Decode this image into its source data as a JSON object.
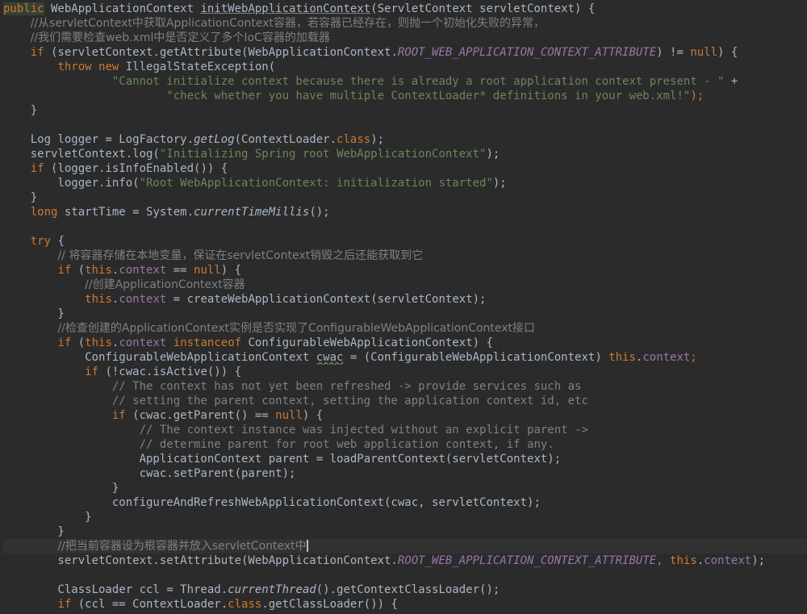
{
  "editor": {
    "caret_line": 37,
    "lines": [
      [
        {
          "t": "public",
          "c": "hlkw"
        },
        {
          "t": " WebApplicationContext ",
          "c": "pl"
        },
        {
          "t": "initWebApplicationContext",
          "c": "ul"
        },
        {
          "t": "(ServletContext servletContext) {",
          "c": "pl"
        }
      ],
      [
        {
          "t": "    ",
          "c": "pl"
        },
        {
          "t": "//从servletContext中获取ApplicationContext容器，若容器已经存在，则抛一个初始化失败的异常，",
          "c": "cmz"
        }
      ],
      [
        {
          "t": "    ",
          "c": "pl"
        },
        {
          "t": "//我们需要检查web.xml中是否定义了多个IoC容器的加载器",
          "c": "cmz"
        }
      ],
      [
        {
          "t": "    ",
          "c": "pl"
        },
        {
          "t": "if",
          "c": "kw"
        },
        {
          "t": " (servletContext.getAttribute(WebApplicationContext.",
          "c": "pl"
        },
        {
          "t": "ROOT_WEB_APPLICATION_CONTEXT_ATTRIBUTE",
          "c": "sfld"
        },
        {
          "t": ") != ",
          "c": "pl"
        },
        {
          "t": "null",
          "c": "kw"
        },
        {
          "t": ") {",
          "c": "pl"
        }
      ],
      [
        {
          "t": "        ",
          "c": "pl"
        },
        {
          "t": "throw new",
          "c": "kw"
        },
        {
          "t": " IllegalStateException(",
          "c": "pl"
        }
      ],
      [
        {
          "t": "                ",
          "c": "pl"
        },
        {
          "t": "\"Cannot initialize context because there is already a root application context present - \"",
          "c": "str"
        },
        {
          "t": " +",
          "c": "pl"
        }
      ],
      [
        {
          "t": "                        ",
          "c": "pl"
        },
        {
          "t": "\"check whether you have multiple ContextLoader* definitions in your web.xml!\"",
          "c": "str"
        },
        {
          "t": ");",
          "c": "kw"
        }
      ],
      [
        {
          "t": "    }",
          "c": "pl"
        }
      ],
      [],
      [
        {
          "t": "    Log logger = LogFactory.",
          "c": "pl"
        },
        {
          "t": "getLog",
          "c": "smeth"
        },
        {
          "t": "(ContextLoader.",
          "c": "pl"
        },
        {
          "t": "class",
          "c": "kw"
        },
        {
          "t": ");",
          "c": "pl"
        }
      ],
      [
        {
          "t": "    servletContext.log(",
          "c": "pl"
        },
        {
          "t": "\"Initializing Spring root WebApplicationContext\"",
          "c": "str"
        },
        {
          "t": ");",
          "c": "pl"
        }
      ],
      [
        {
          "t": "    ",
          "c": "pl"
        },
        {
          "t": "if",
          "c": "kw"
        },
        {
          "t": " (logger.isInfoEnabled()) {",
          "c": "pl"
        }
      ],
      [
        {
          "t": "        logger.info(",
          "c": "pl"
        },
        {
          "t": "\"Root WebApplicationContext: initialization started\"",
          "c": "str"
        },
        {
          "t": ");",
          "c": "pl"
        }
      ],
      [
        {
          "t": "    }",
          "c": "pl"
        }
      ],
      [
        {
          "t": "    ",
          "c": "pl"
        },
        {
          "t": "long",
          "c": "kw"
        },
        {
          "t": " startTime = System.",
          "c": "pl"
        },
        {
          "t": "currentTimeMillis",
          "c": "smeth"
        },
        {
          "t": "();",
          "c": "pl"
        }
      ],
      [],
      [
        {
          "t": "    ",
          "c": "pl"
        },
        {
          "t": "try",
          "c": "kw"
        },
        {
          "t": " {",
          "c": "pl"
        }
      ],
      [
        {
          "t": "        ",
          "c": "pl"
        },
        {
          "t": "// 将容器存储在本地变量，保证在servletContext销毁之后还能获取到它",
          "c": "cmz"
        }
      ],
      [
        {
          "t": "        ",
          "c": "pl"
        },
        {
          "t": "if",
          "c": "kw"
        },
        {
          "t": " (",
          "c": "pl"
        },
        {
          "t": "this",
          "c": "kw"
        },
        {
          "t": ".",
          "c": "pl"
        },
        {
          "t": "context",
          "c": "fld"
        },
        {
          "t": " == ",
          "c": "pl"
        },
        {
          "t": "null",
          "c": "kw"
        },
        {
          "t": ") {",
          "c": "pl"
        }
      ],
      [
        {
          "t": "            ",
          "c": "pl"
        },
        {
          "t": "//创建ApplicationContext容器",
          "c": "cmz"
        }
      ],
      [
        {
          "t": "            ",
          "c": "pl"
        },
        {
          "t": "this",
          "c": "kw"
        },
        {
          "t": ".",
          "c": "pl"
        },
        {
          "t": "context",
          "c": "fld"
        },
        {
          "t": " = createWebApplicationContext(servletContext);",
          "c": "pl"
        }
      ],
      [
        {
          "t": "        }",
          "c": "pl"
        }
      ],
      [
        {
          "t": "        ",
          "c": "pl"
        },
        {
          "t": "//检查创建的ApplicationContext实例是否实现了ConfigurableWebApplicationContext接口",
          "c": "cmz"
        }
      ],
      [
        {
          "t": "        ",
          "c": "pl"
        },
        {
          "t": "if",
          "c": "kw"
        },
        {
          "t": " (",
          "c": "pl"
        },
        {
          "t": "this",
          "c": "kw"
        },
        {
          "t": ".",
          "c": "pl"
        },
        {
          "t": "context",
          "c": "fld"
        },
        {
          "t": " ",
          "c": "pl"
        },
        {
          "t": "instanceof",
          "c": "kw"
        },
        {
          "t": " ConfigurableWebApplicationContext) {",
          "c": "pl"
        }
      ],
      [
        {
          "t": "            ConfigurableWebApplicationContext ",
          "c": "pl"
        },
        {
          "t": "cwac",
          "c": "squig"
        },
        {
          "t": " = (ConfigurableWebApplicationContext) ",
          "c": "pl"
        },
        {
          "t": "this",
          "c": "kw"
        },
        {
          "t": ".",
          "c": "pl"
        },
        {
          "t": "context",
          "c": "fld"
        },
        {
          "t": ";",
          "c": "kw"
        }
      ],
      [
        {
          "t": "            ",
          "c": "pl"
        },
        {
          "t": "if",
          "c": "kw"
        },
        {
          "t": " (!cwac.isActive()) {",
          "c": "pl"
        }
      ],
      [
        {
          "t": "                ",
          "c": "pl"
        },
        {
          "t": "// The context has not yet been refreshed -> provide services such as",
          "c": "cm"
        }
      ],
      [
        {
          "t": "                ",
          "c": "pl"
        },
        {
          "t": "// setting the parent context, setting the application context id, etc",
          "c": "cm"
        }
      ],
      [
        {
          "t": "                ",
          "c": "pl"
        },
        {
          "t": "if",
          "c": "kw"
        },
        {
          "t": " (cwac.getParent() == ",
          "c": "pl"
        },
        {
          "t": "null",
          "c": "kw"
        },
        {
          "t": ") {",
          "c": "pl"
        }
      ],
      [
        {
          "t": "                    ",
          "c": "pl"
        },
        {
          "t": "// The context instance was injected without an explicit parent ->",
          "c": "cm"
        }
      ],
      [
        {
          "t": "                    ",
          "c": "pl"
        },
        {
          "t": "// determine parent for root web application context, if any.",
          "c": "cm"
        }
      ],
      [
        {
          "t": "                    ApplicationContext parent = loadParentContext(servletContext);",
          "c": "pl"
        }
      ],
      [
        {
          "t": "                    cwac.setParent(parent);",
          "c": "pl"
        }
      ],
      [
        {
          "t": "                }",
          "c": "pl"
        }
      ],
      [
        {
          "t": "                configureAndRefreshWebApplicationContext(cwac, servletContext);",
          "c": "pl"
        }
      ],
      [
        {
          "t": "            }",
          "c": "pl"
        }
      ],
      [
        {
          "t": "        }",
          "c": "pl"
        }
      ],
      [
        {
          "t": "        ",
          "c": "pl"
        },
        {
          "t": "//把当前容器设为根容器并放入servletContext中",
          "c": "cmz"
        }
      ],
      [
        {
          "t": "        servletContext.setAttribute(WebApplicationContext.",
          "c": "pl"
        },
        {
          "t": "ROOT_WEB_APPLICATION_CONTEXT_ATTRIBUTE",
          "c": "sfld"
        },
        {
          "t": ", ",
          "c": "kw"
        },
        {
          "t": "this",
          "c": "kw"
        },
        {
          "t": ".",
          "c": "pl"
        },
        {
          "t": "context",
          "c": "fld"
        },
        {
          "t": ");",
          "c": "pl"
        }
      ],
      [],
      [
        {
          "t": "        ClassLoader ccl = Thread.",
          "c": "pl"
        },
        {
          "t": "currentThread",
          "c": "smeth"
        },
        {
          "t": "().getContextClassLoader();",
          "c": "pl"
        }
      ],
      [
        {
          "t": "        ",
          "c": "pl"
        },
        {
          "t": "if",
          "c": "kw"
        },
        {
          "t": " (ccl == ContextLoader.",
          "c": "pl"
        },
        {
          "t": "class",
          "c": "kw"
        },
        {
          "t": ".getClassLoader()) {",
          "c": "pl"
        }
      ]
    ]
  }
}
